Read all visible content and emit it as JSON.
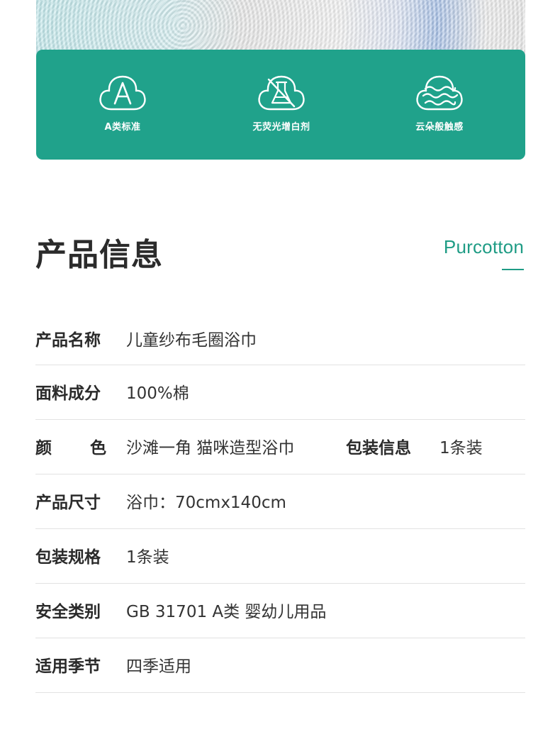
{
  "features": [
    {
      "icon": "grade-a-cloud-icon",
      "label": "A类标准"
    },
    {
      "icon": "no-fluorescent-flask-icon",
      "label": "无荧光增白剂"
    },
    {
      "icon": "cloud-waves-icon",
      "label": "云朵般触感"
    }
  ],
  "section": {
    "title": "产品信息",
    "brand": "Purcotton"
  },
  "specs": {
    "name": {
      "key": "产品名称",
      "value": "儿童纱布毛圈浴巾"
    },
    "fabric": {
      "key": "面料成分",
      "value": "100%棉"
    },
    "color": {
      "key_chars": [
        "颜",
        "色"
      ],
      "value": "沙滩一角 猫咪造型浴巾",
      "key2": "包装信息",
      "value2": "1条装"
    },
    "size": {
      "key": "产品尺寸",
      "value": "浴巾：70cmx140cm"
    },
    "packaging": {
      "key": "包装规格",
      "value": "1条装"
    },
    "safety": {
      "key": "安全类别",
      "value": "GB 31701 A类 婴幼儿用品"
    },
    "season": {
      "key": "适用季节",
      "value": "四季适用"
    }
  },
  "colors": {
    "accent": "#20a28b",
    "brand": "#1f9c85"
  }
}
